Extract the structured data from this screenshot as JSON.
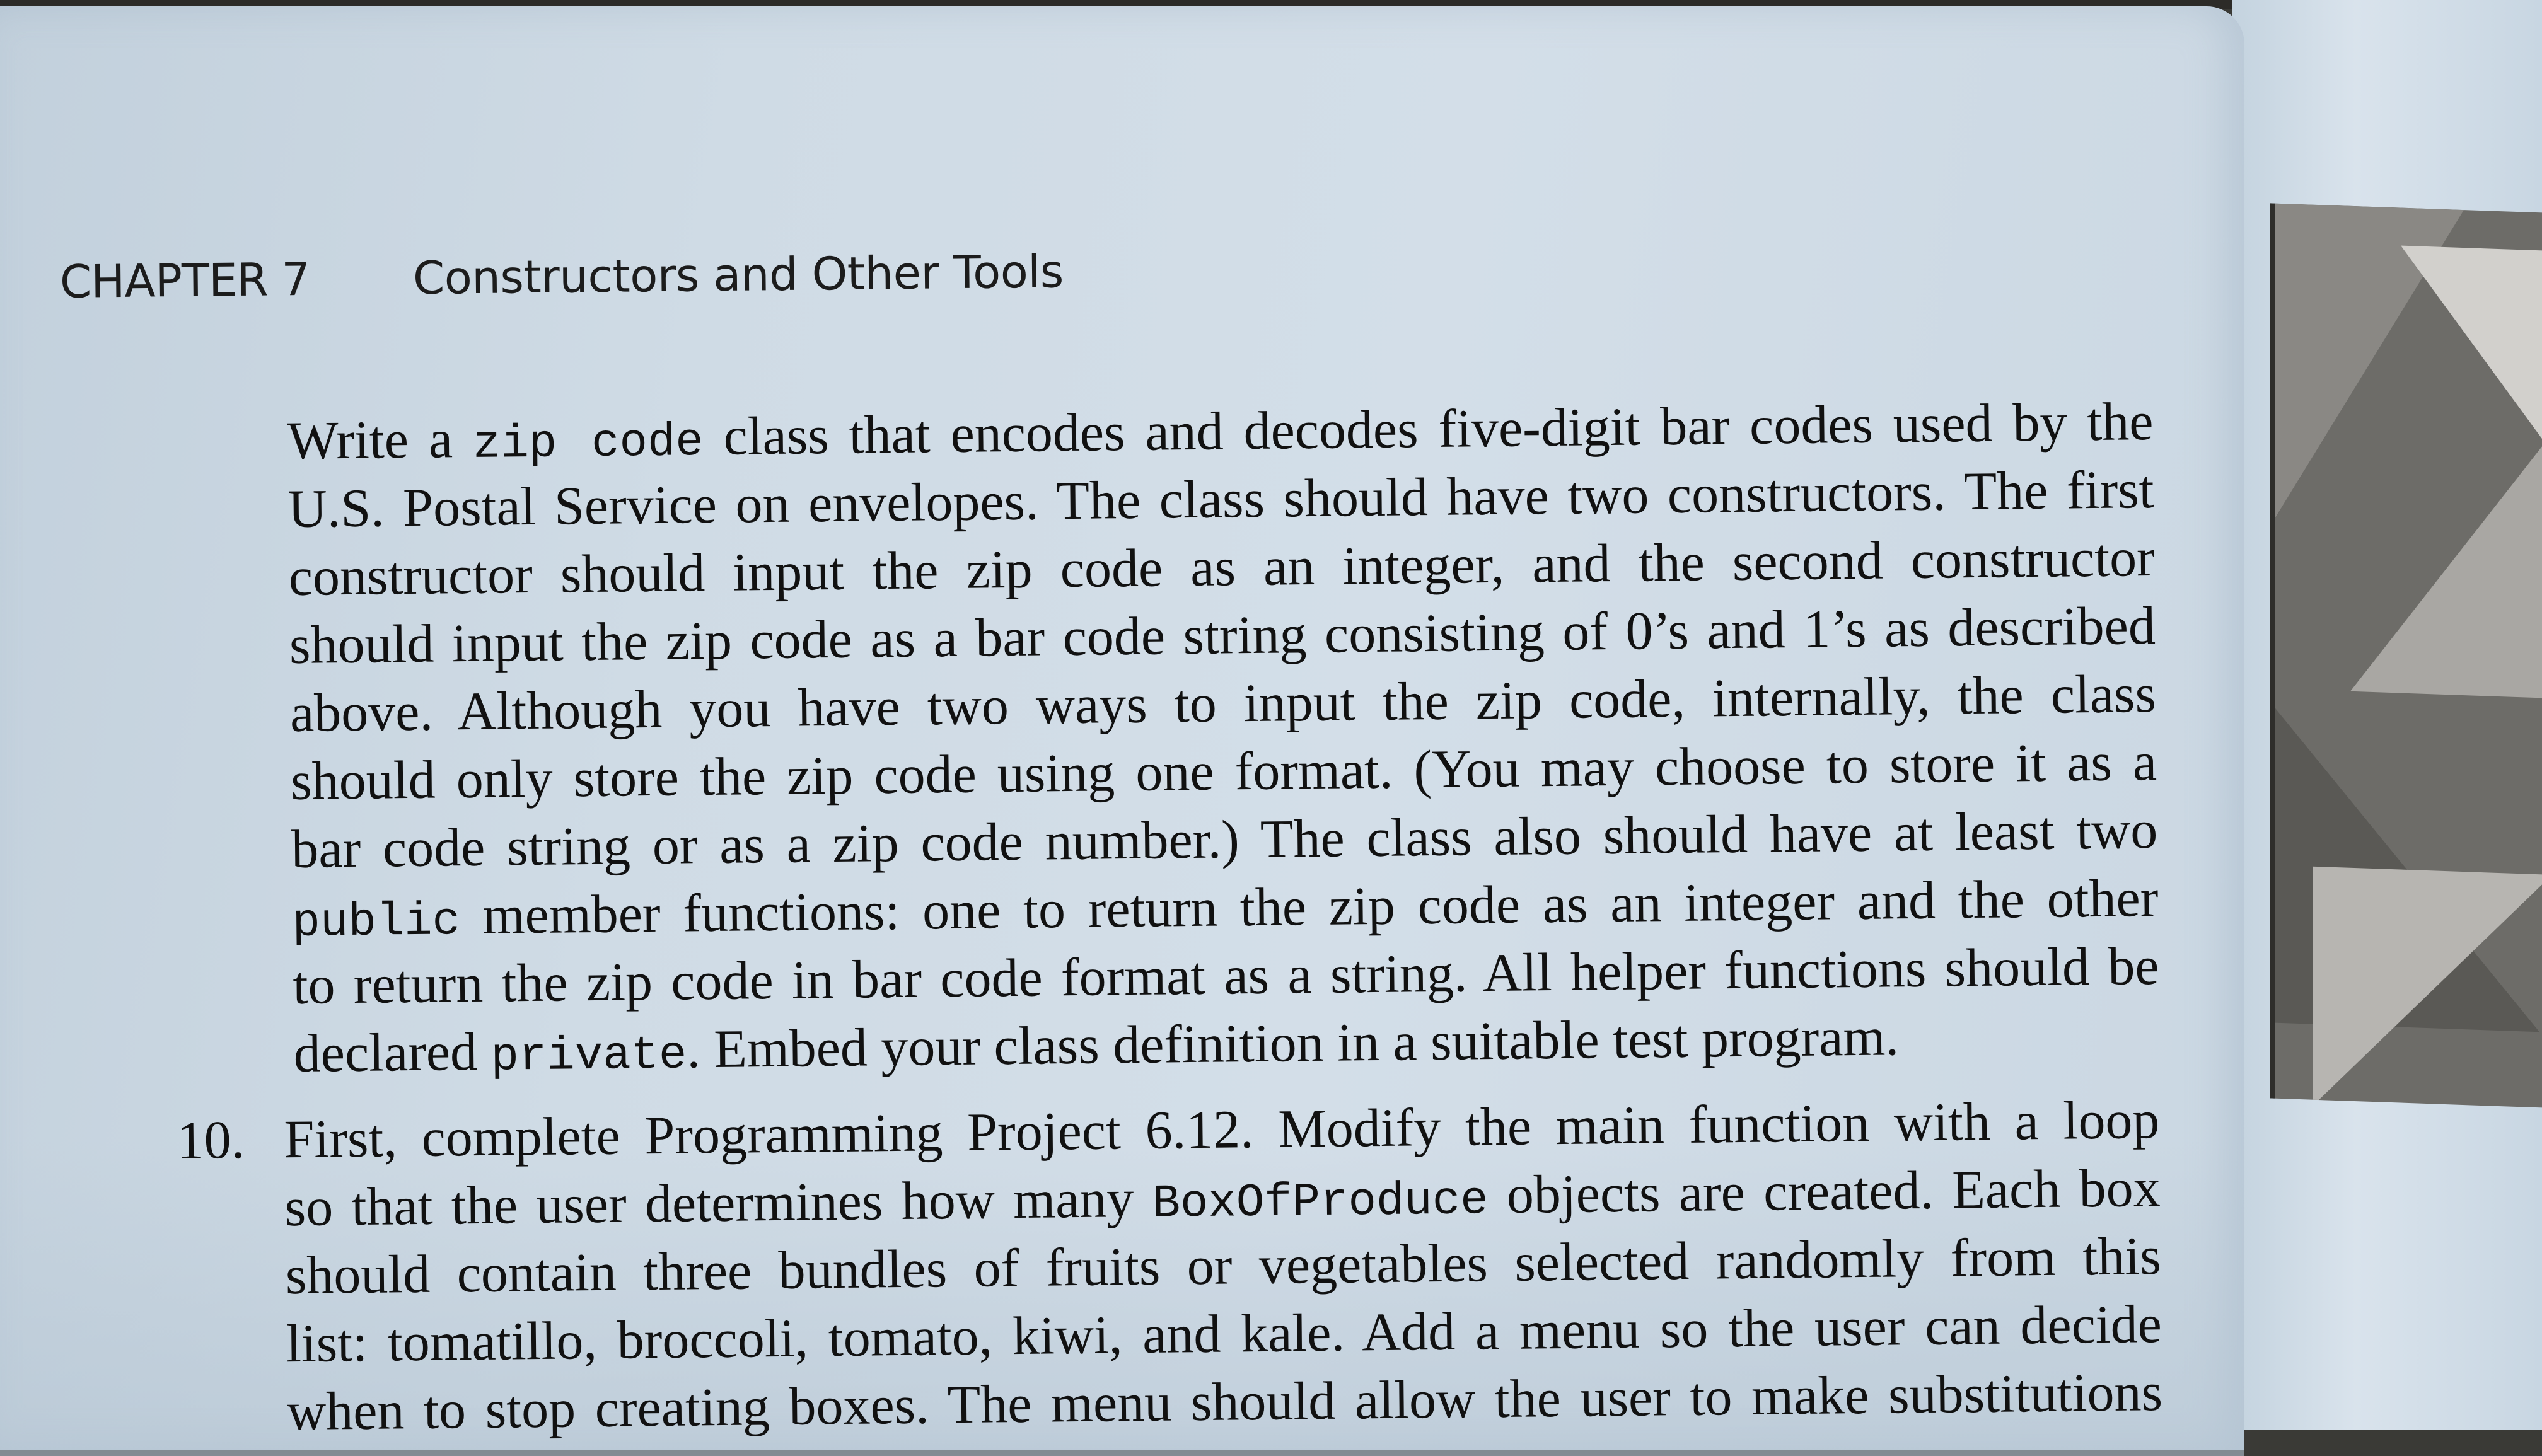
{
  "running_head": {
    "chapter": "CHAPTER 7",
    "title": "Constructors and Other Tools"
  },
  "paragraph_lines": [
    [
      {
        "t": "Write a "
      },
      {
        "t": "zip code",
        "code": true
      },
      {
        "t": " class that encodes and decodes five-digit bar codes used by the"
      }
    ],
    [
      {
        "t": "U.S. Postal Service on envelopes. The class should have two constructors. The first"
      }
    ],
    [
      {
        "t": "constructor should input the zip code as an integer, and the second constructor"
      }
    ],
    [
      {
        "t": "should input the zip code as a bar code string consisting of 0’s and 1’s as described"
      }
    ],
    [
      {
        "t": "above. Although you have two ways to input the zip code, internally, the class"
      }
    ],
    [
      {
        "t": "should only store the zip code using one format. (You may choose to store it as a"
      }
    ],
    [
      {
        "t": "bar code string or as a zip code number.) The class also should have at least two"
      }
    ],
    [
      {
        "t": "public",
        "code": true
      },
      {
        "t": " member functions: one to return the zip code as an integer and the other"
      }
    ],
    [
      {
        "t": "to return the zip code in bar code format as a string. All helper functions should be"
      }
    ],
    [
      {
        "t": "declared "
      },
      {
        "t": "private",
        "code": true
      },
      {
        "t": ". Embed your class definition in a suitable test program."
      }
    ]
  ],
  "item10": {
    "number": "10.",
    "lines": [
      [
        {
          "t": "First, complete Programming Project 6.12. Modify the main function with a loop"
        }
      ],
      [
        {
          "t": "so that the user determines how many "
        },
        {
          "t": "BoxOfProduce",
          "code": true
        },
        {
          "t": " objects are created. Each box"
        }
      ],
      [
        {
          "t": "should contain three bundles of fruits or vegetables selected randomly from this"
        }
      ],
      [
        {
          "t": "list: tomatillo, broccoli, tomato, kiwi, and kale. Add a menu so the user can decide"
        }
      ],
      [
        {
          "t": "when to stop creating boxes. The menu should allow the user to make substitutions"
        }
      ]
    ]
  }
}
